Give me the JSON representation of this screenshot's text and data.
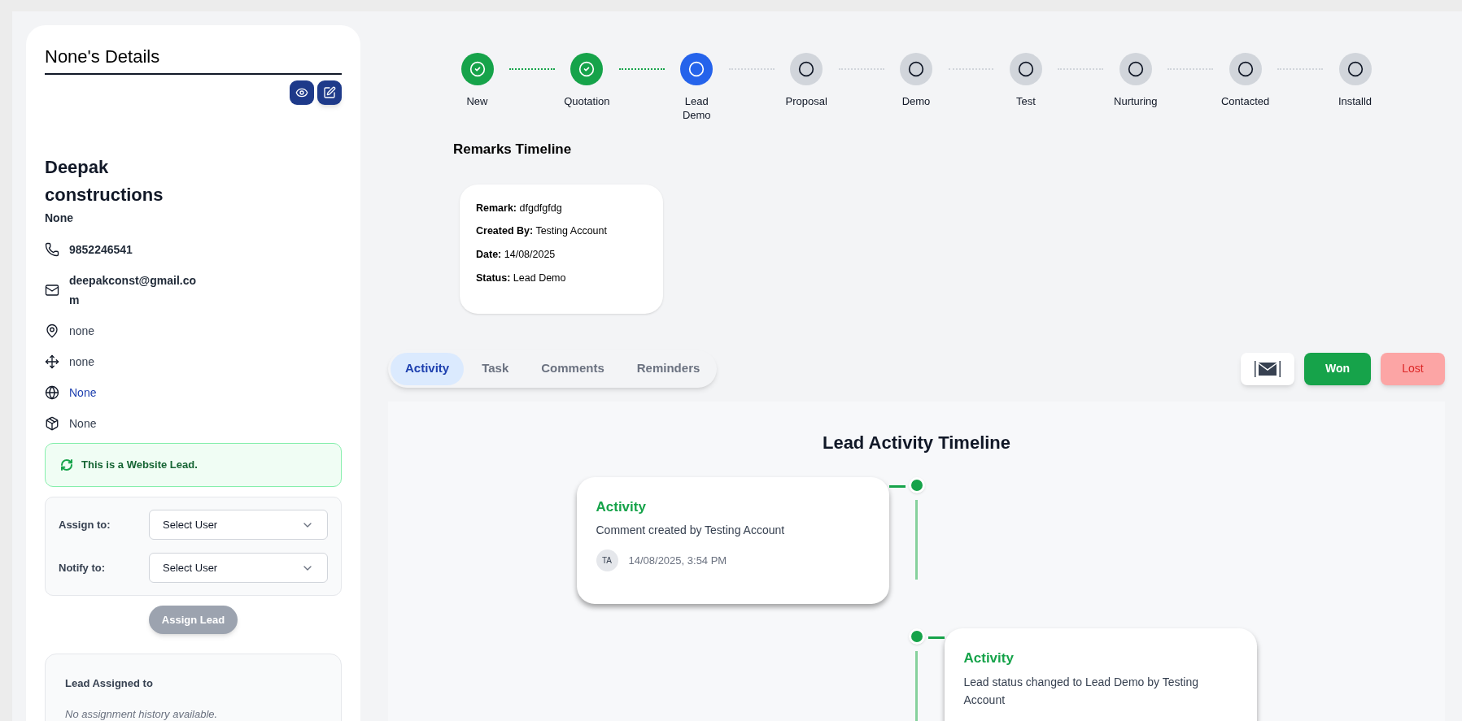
{
  "details": {
    "title": "None's Details",
    "company": "Deepak constructions",
    "contact_name": "None",
    "info": [
      {
        "kind": "phone",
        "value": "9852246541"
      },
      {
        "kind": "email",
        "value": "deepakconst@gmail.com"
      },
      {
        "kind": "location",
        "value": "none"
      },
      {
        "kind": "move",
        "value": "none"
      },
      {
        "kind": "website",
        "value": "None"
      },
      {
        "kind": "product",
        "value": "None"
      }
    ],
    "website_lead_notice": "This is a Website Lead.",
    "assign": {
      "fields": [
        {
          "label": "Assign to:",
          "placeholder": "Select User"
        },
        {
          "label": "Notify to:",
          "placeholder": "Select User"
        }
      ],
      "button": {
        "label": "Assign Lead",
        "disabled": true
      }
    },
    "history": {
      "title": "Lead Assigned to",
      "empty": "No assignment history available."
    }
  },
  "stages": [
    {
      "label": "New",
      "kind": "done"
    },
    {
      "label": "Quotation",
      "kind": "done"
    },
    {
      "label": "Lead Demo",
      "kind": "current"
    },
    {
      "label": "Proposal",
      "kind": "pending"
    },
    {
      "label": "Demo",
      "kind": "pending"
    },
    {
      "label": "Test",
      "kind": "pending"
    },
    {
      "label": "Nurturing",
      "kind": "pending"
    },
    {
      "label": "Contacted",
      "kind": "pending"
    },
    {
      "label": "Installd",
      "kind": "pending"
    }
  ],
  "remarks": {
    "title": "Remarks Timeline",
    "items": [
      {
        "fields": [
          {
            "label": "Remark:",
            "value": "dfgdfgfdg"
          },
          {
            "label": "Created By:",
            "value": "Testing Account"
          },
          {
            "label": "Date:",
            "value": "14/08/2025"
          },
          {
            "label": "Status:",
            "value": "Lead Demo"
          }
        ]
      }
    ]
  },
  "tabs": [
    {
      "label": "Activity",
      "selected": true
    },
    {
      "label": "Task",
      "selected": false
    },
    {
      "label": "Comments",
      "selected": false
    },
    {
      "label": "Reminders",
      "selected": false
    }
  ],
  "actions": [
    {
      "kind": "mail"
    },
    {
      "kind": "won",
      "label": "Won"
    },
    {
      "kind": "lost",
      "label": "Lost"
    }
  ],
  "activity": {
    "title": "Lead Activity Timeline",
    "entries": [
      {
        "kind": "left",
        "title": "Activity",
        "text": "Comment created by Testing Account",
        "initials": "TA",
        "time": "14/08/2025, 3:54 PM"
      },
      {
        "kind": "right",
        "title": "Activity",
        "text": "Lead status changed to Lead Demo by Testing Account"
      }
    ]
  }
}
